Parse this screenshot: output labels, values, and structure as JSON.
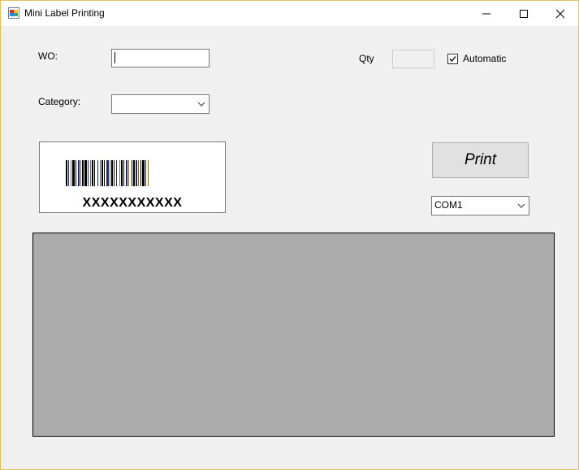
{
  "window": {
    "title": "Mini Label Printing",
    "icon": "app-window-icon",
    "controls": [
      "minimize-icon",
      "maximize-icon",
      "close-icon"
    ]
  },
  "form": {
    "wo_label": "WO:",
    "wo_value": "",
    "category_label": "Category:",
    "category_value": "",
    "qty_label": "Qty",
    "qty_value": "",
    "automatic_label": "Automatic",
    "automatic_checked": true
  },
  "preview": {
    "barcode_text": "XXXXXXXXXXX"
  },
  "actions": {
    "print_label": "Print"
  },
  "port": {
    "selected": "COM1"
  },
  "colors": {
    "window_border": "#e0c060",
    "form_background": "#f0f0f0",
    "log_panel": "#ababab"
  }
}
